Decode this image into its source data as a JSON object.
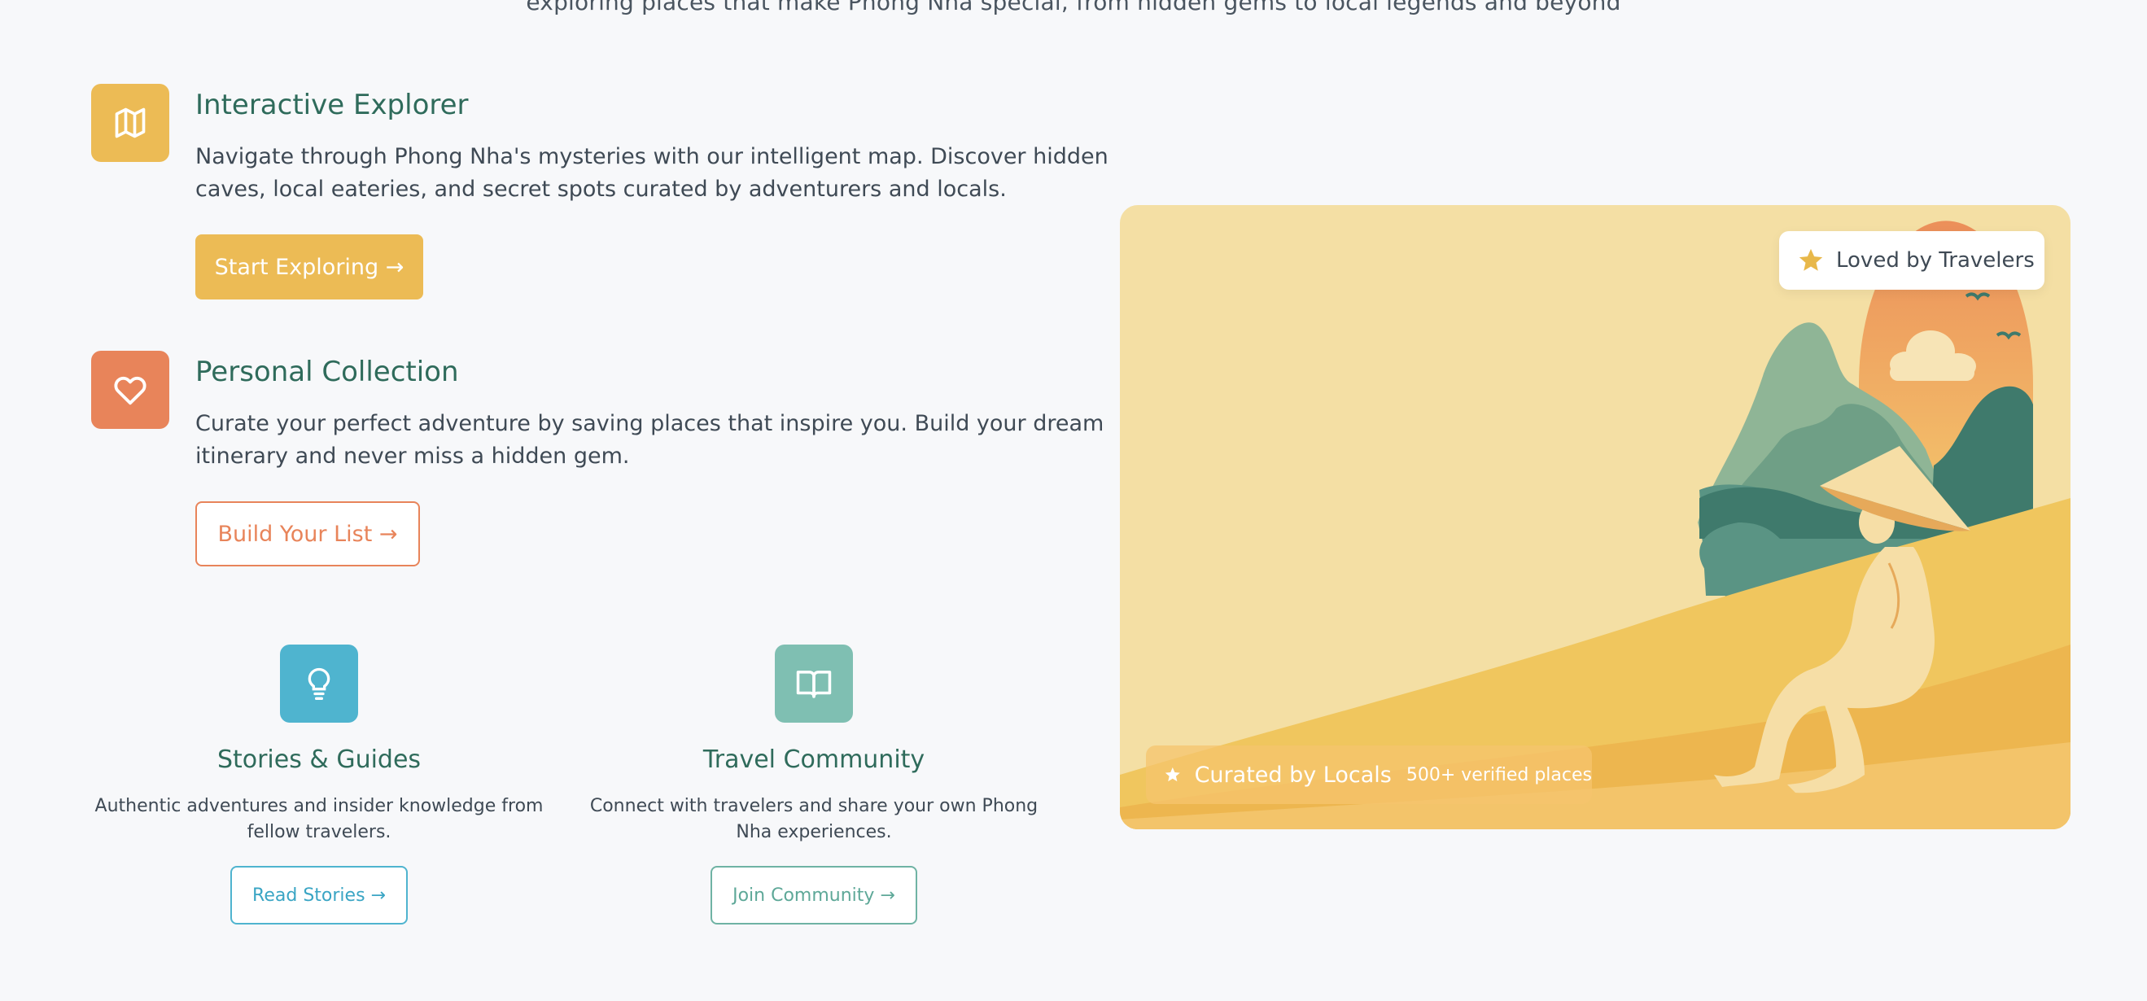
{
  "intro": {
    "partial_text": "exploring places that make Phong Nha special, from hidden gems to local legends and beyond"
  },
  "features": [
    {
      "title": "Interactive Explorer",
      "description": "Navigate through Phong Nha's mysteries with our intelligent map. Discover hidden caves, local eateries, and secret spots curated by adventurers and locals.",
      "button": "Start Exploring →",
      "icon": "map-icon",
      "color": "#ecbb55"
    },
    {
      "title": "Personal Collection",
      "description": "Curate your perfect adventure by saving places that inspire you. Build your dream itinerary and never miss a hidden gem.",
      "button": "Build Your List →",
      "icon": "heart-icon",
      "color": "#e8845a"
    }
  ],
  "cards": [
    {
      "title": "Stories & Guides",
      "description": "Authentic adventures and insider knowledge from fellow travelers.",
      "button": "Read Stories →",
      "icon": "lightbulb-icon",
      "color": "#4fb4cf"
    },
    {
      "title": "Travel Community",
      "description": "Connect with travelers and share your own Phong Nha experiences.",
      "button": "Join Community →",
      "icon": "book-open-icon",
      "color": "#7fbfb2"
    }
  ],
  "hero": {
    "badge_top": "Loved by Travelers",
    "badge_bottom_main": "Curated by Locals",
    "badge_bottom_sub": "500+ verified places",
    "background_color": "#f4dfa4",
    "accent_color": "#ecbb55"
  }
}
